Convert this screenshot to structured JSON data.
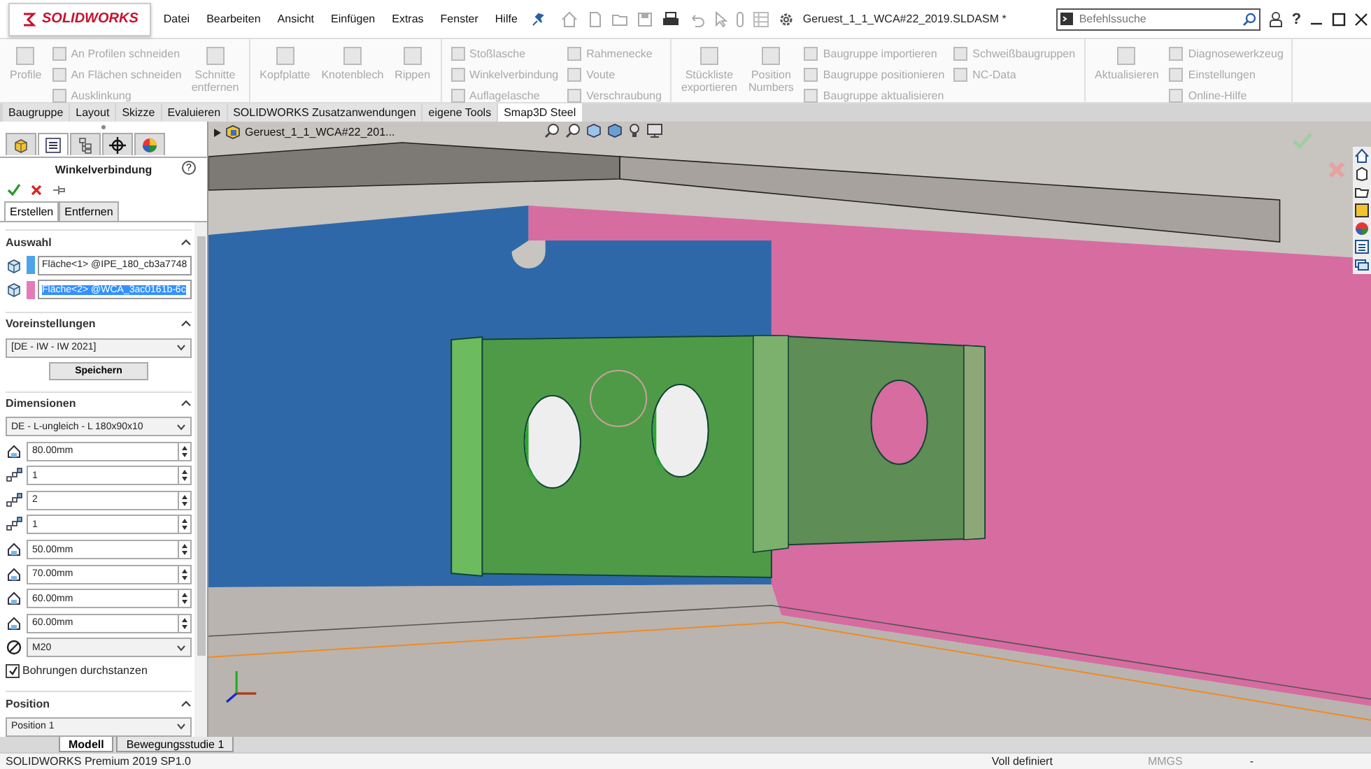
{
  "app": {
    "logo": "SOLIDWORKS",
    "menu": [
      "Datei",
      "Bearbeiten",
      "Ansicht",
      "Einfügen",
      "Extras",
      "Fenster",
      "Hilfe"
    ],
    "document_title": "Geruest_1_1_WCA#22_2019.SLDASM *",
    "search": {
      "placeholder": "Befehlssuche"
    },
    "help_symbol": "?"
  },
  "ribbon": {
    "groups": [
      {
        "items": [
          {
            "kind": "large",
            "label": "Profile",
            "disabled": true
          },
          {
            "kind": "stack",
            "items": [
              {
                "label": "An Profilen schneiden",
                "disabled": true
              },
              {
                "label": "An Flächen schneiden",
                "disabled": true
              },
              {
                "label": "Ausklinkung",
                "disabled": true
              }
            ]
          },
          {
            "kind": "large",
            "label": "Schnitte entfernen",
            "disabled": true
          }
        ]
      },
      {
        "items": [
          {
            "kind": "large",
            "label": "Kopfplatte",
            "disabled": true
          },
          {
            "kind": "large",
            "label": "Knotenblech",
            "disabled": true
          },
          {
            "kind": "large",
            "label": "Rippen",
            "disabled": true
          }
        ]
      },
      {
        "items": [
          {
            "kind": "stack",
            "items": [
              {
                "label": "Stoßlasche",
                "disabled": true
              },
              {
                "label": "Winkelverbindung",
                "disabled": true
              },
              {
                "label": "Auflagelasche",
                "disabled": true
              }
            ]
          },
          {
            "kind": "stack",
            "items": [
              {
                "label": "Rahmenecke",
                "disabled": true
              },
              {
                "label": "Voute",
                "disabled": true
              },
              {
                "label": "Verschraubung",
                "disabled": true
              }
            ]
          }
        ]
      },
      {
        "items": [
          {
            "kind": "large",
            "label": "Stückliste exportieren",
            "disabled": true
          },
          {
            "kind": "large",
            "label": "Position Numbers",
            "disabled": true
          },
          {
            "kind": "stack",
            "items": [
              {
                "label": "Baugruppe importieren",
                "disabled": true
              },
              {
                "label": "Baugruppe positionieren",
                "disabled": true
              },
              {
                "label": "Baugruppe aktualisieren",
                "disabled": true
              }
            ]
          },
          {
            "kind": "stack",
            "items": [
              {
                "label": "Schweißbaugruppen",
                "disabled": true
              },
              {
                "label": "NC-Data",
                "disabled": true
              }
            ]
          }
        ]
      },
      {
        "items": [
          {
            "kind": "large",
            "label": "Aktualisieren",
            "disabled": true
          },
          {
            "kind": "stack",
            "items": [
              {
                "label": "Diagnosewerkzeug",
                "disabled": true
              },
              {
                "label": "Einstellungen",
                "disabled": true
              },
              {
                "label": "Online-Hilfe",
                "disabled": true
              }
            ]
          }
        ]
      }
    ]
  },
  "command_tabs": [
    {
      "label": "Baugruppe",
      "selected": false
    },
    {
      "label": "Layout",
      "selected": false
    },
    {
      "label": "Skizze",
      "selected": false
    },
    {
      "label": "Evaluieren",
      "selected": false
    },
    {
      "label": "SOLIDWORKS Zusatzanwendungen",
      "selected": false
    },
    {
      "label": "eigene Tools",
      "selected": false
    },
    {
      "label": "Smap3D Steel",
      "selected": true
    }
  ],
  "property_manager": {
    "panel_tabs": [
      {
        "kind": "feature",
        "selected": false
      },
      {
        "kind": "property",
        "selected": true
      },
      {
        "kind": "config",
        "selected": false
      },
      {
        "kind": "target",
        "selected": false
      },
      {
        "kind": "display",
        "selected": false
      }
    ],
    "title": "Winkelverbindung",
    "subtabs": [
      {
        "label": "Erstellen",
        "selected": true
      },
      {
        "label": "Entfernen",
        "selected": false
      }
    ],
    "sections": [
      {
        "kind": "selection",
        "title": "Auswahl",
        "expanded": true,
        "selections": [
          {
            "value": "Fläche<1> @IPE_180_cb3a7748",
            "color": "#4da3ec",
            "selected": false
          },
          {
            "value": "Fläche<2> @WCA_3ac0161b-6c",
            "color": "#e57bb8",
            "selected": true
          }
        ]
      },
      {
        "kind": "presets",
        "title": "Voreinstellungen",
        "expanded": true,
        "dropdown": "[DE - IW - IW 2021]",
        "button": "Speichern"
      },
      {
        "kind": "dimensions",
        "title": "Dimensionen",
        "expanded": true,
        "dropdown": "DE - L-ungleich - L 180x90x10",
        "fields": [
          {
            "kind": "length",
            "value": "80.00mm"
          },
          {
            "kind": "count",
            "value": "1"
          },
          {
            "kind": "count",
            "value": "2"
          },
          {
            "kind": "count",
            "value": "1"
          },
          {
            "kind": "length",
            "value": "50.00mm"
          },
          {
            "kind": "length",
            "value": "70.00mm"
          },
          {
            "kind": "length",
            "value": "60.00mm"
          },
          {
            "kind": "length",
            "value": "60.00mm"
          }
        ],
        "bolt": "M20",
        "checkbox": {
          "label": "Bohrungen durchstanzen",
          "checked": true
        }
      },
      {
        "kind": "position",
        "title": "Position",
        "expanded": true,
        "dropdown": "Position 1"
      }
    ]
  },
  "viewport": {
    "tree_item": "Geruest_1_1_WCA#22_201..."
  },
  "bottom_tabs": [
    {
      "label": "Modell",
      "selected": true
    },
    {
      "label": "Bewegungsstudie 1",
      "selected": false
    }
  ],
  "status_bar": {
    "product": "SOLIDWORKS Premium 2019 SP1.0",
    "state": "Voll definiert",
    "units": "MMGS",
    "extra": "-"
  }
}
